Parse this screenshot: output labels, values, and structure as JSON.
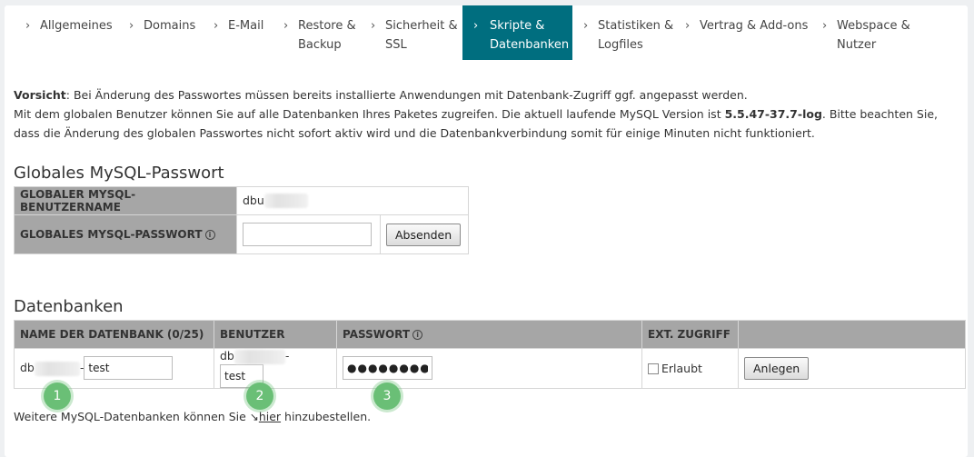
{
  "tabs": [
    {
      "label": "Allgemeines",
      "active": false
    },
    {
      "label": "Domains",
      "active": false
    },
    {
      "label": "E-Mail",
      "active": false
    },
    {
      "label": "Restore &\nBackup",
      "active": false
    },
    {
      "label": "Sicherheit &\nSSL",
      "active": false
    },
    {
      "label": "Skripte &\nDatenbanken",
      "active": true
    },
    {
      "label": "Statistiken &\nLogfiles",
      "active": false
    },
    {
      "label": "Vertrag & Add-ons",
      "active": false
    },
    {
      "label": "Webspace &\nNutzer",
      "active": false
    }
  ],
  "intro": {
    "warning_label": "Vorsicht",
    "warning_text": ": Bei Änderung des Passwortes müssen bereits installierte Anwendungen mit Datenbank-Zugriff ggf. angepasst werden.",
    "line2_a": "Mit dem globalen Benutzer können Sie auf alle Datenbanken Ihres Paketes zugreifen. Die aktuell laufende MySQL Version ist ",
    "mysql_version": "5.5.47-37.7-log",
    "line2_b": ". Bitte beachten Sie, dass die Änderung des globalen Passwortes nicht sofort aktiv wird und die Datenbankverbindung somit für einige Minuten nicht funktioniert."
  },
  "global": {
    "heading": "Globales MySQL-Passwort",
    "user_label": "GLOBALER MYSQL-BENUTZERNAME",
    "user_prefix": "dbu",
    "password_label": "GLOBALES MYSQL-PASSWORT",
    "password_value": "",
    "submit_label": "Absenden"
  },
  "databases": {
    "heading": "Datenbanken",
    "columns": [
      "NAME DER DATENBANK (0/25)",
      "BENUTZER",
      "PASSWORT",
      "EXT. ZUGRIFF",
      ""
    ],
    "row": {
      "name_prefix": "db",
      "name_value": "test",
      "user_prefix": "db",
      "user_value": "test",
      "password_value": "●●●●●●●●",
      "ext_access_label": "Erlaubt",
      "ext_access_checked": false,
      "create_label": "Anlegen"
    }
  },
  "markers": [
    "1",
    "2",
    "3"
  ],
  "footer": {
    "before": "Weitere MySQL-Datenbanken können Sie ",
    "link": "hier",
    "after": " hinzubestellen."
  },
  "colors": {
    "active_tab": "#006e7f",
    "table_header": "#a6a6a6",
    "marker": "#6abf76"
  },
  "icons": {
    "tab_chevron": "chevron-right-icon",
    "info": "info-icon",
    "link_arrow": "arrow-icon"
  }
}
